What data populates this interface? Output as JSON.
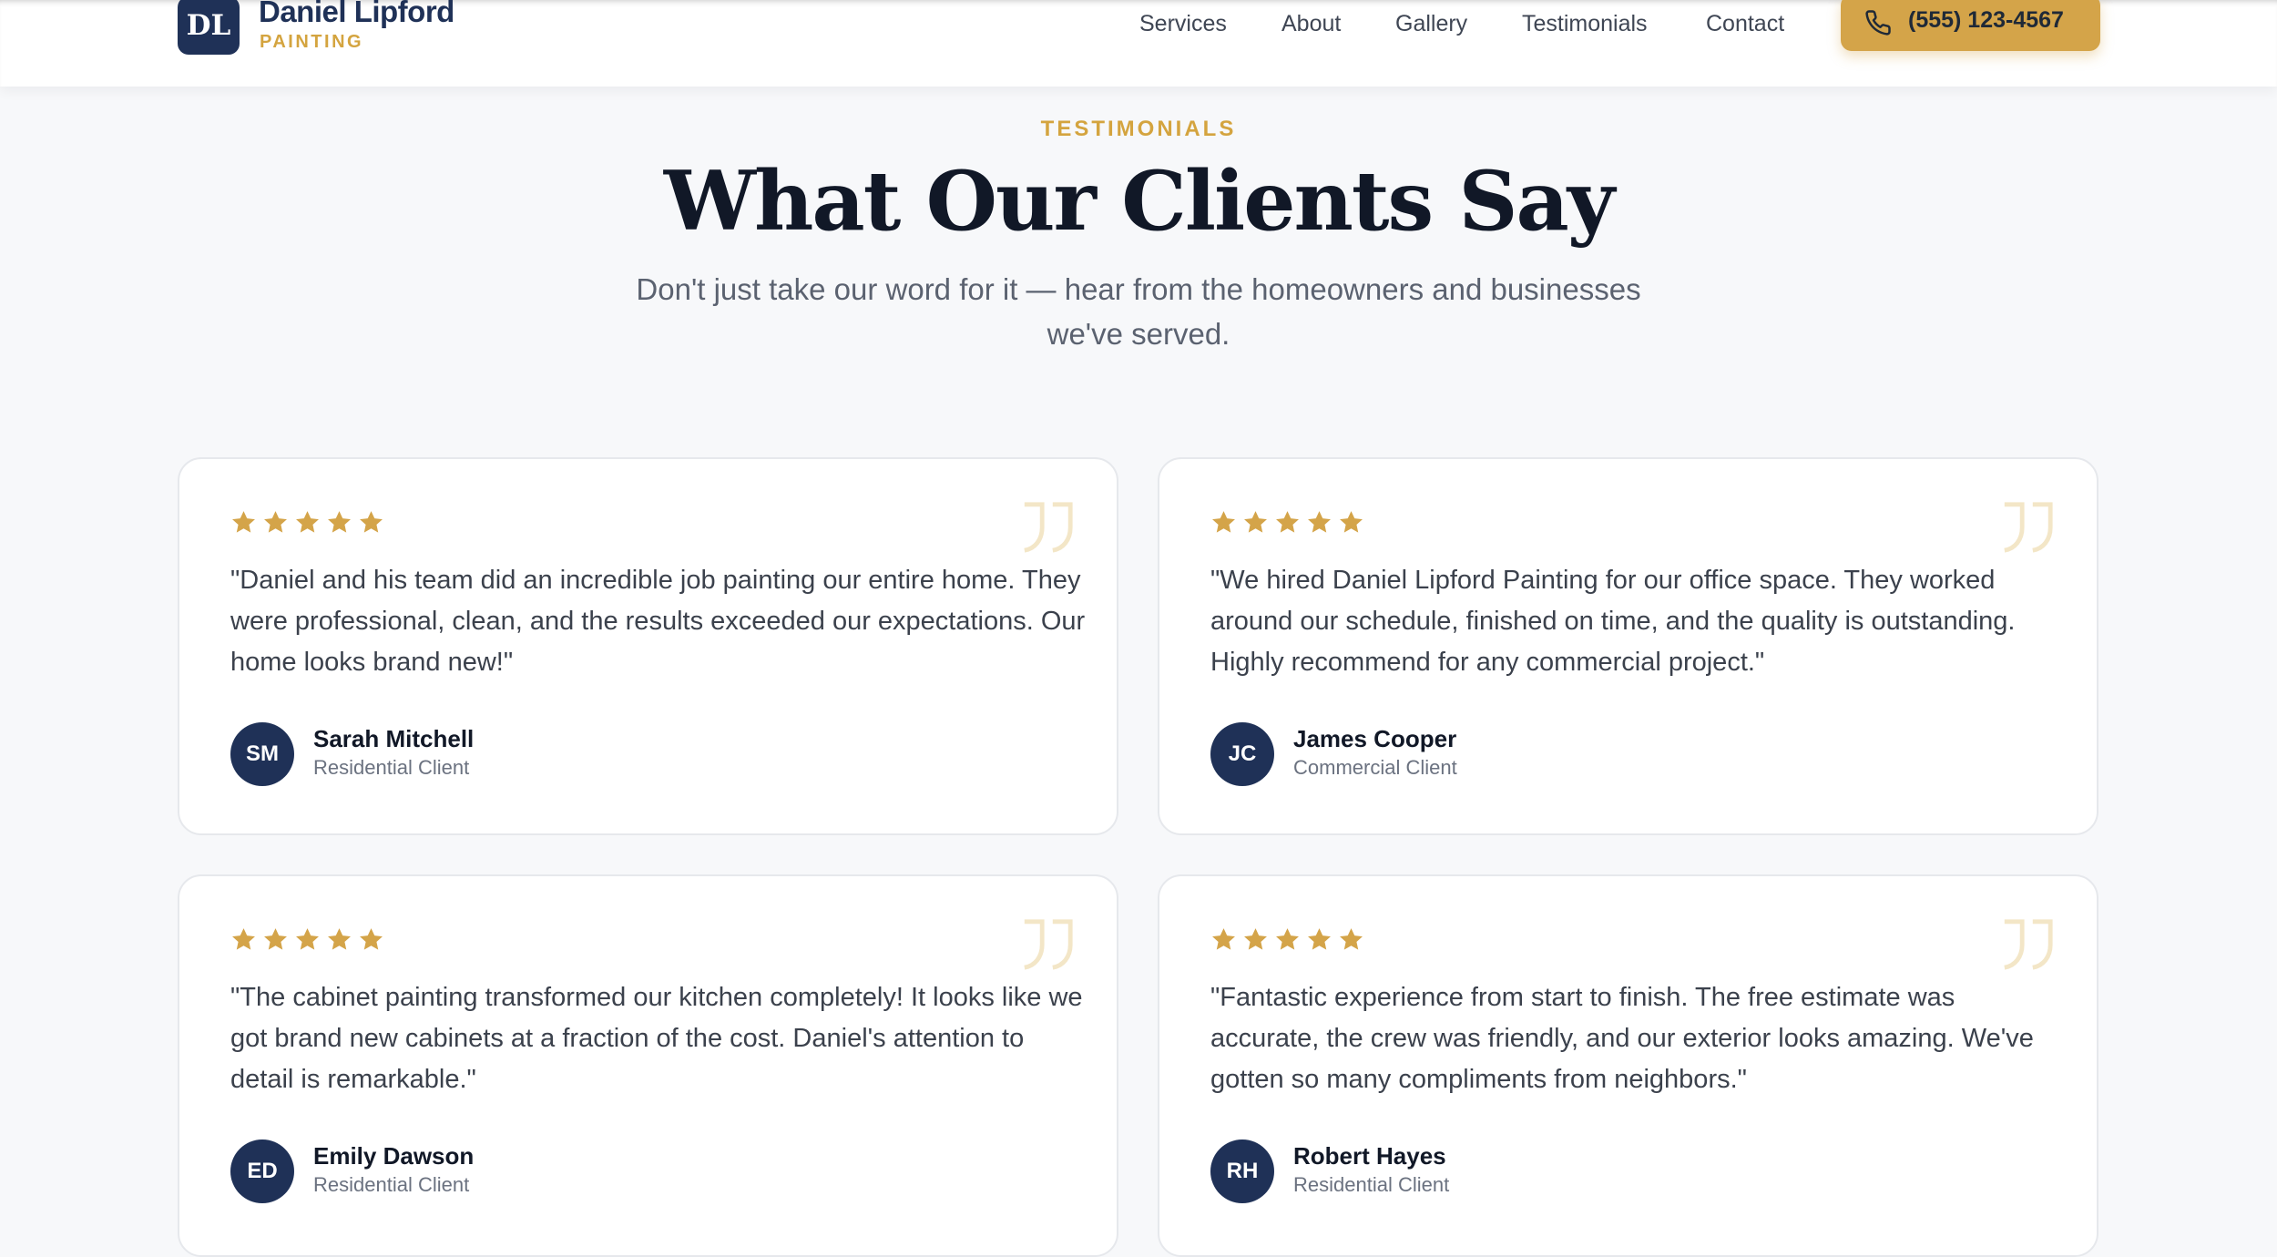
{
  "header": {
    "logo_initials": "DL",
    "brand_name": "Daniel Lipford",
    "brand_sub": "PAINTING",
    "nav": [
      "Services",
      "About",
      "Gallery",
      "Testimonials",
      "Contact"
    ],
    "phone": "(555) 123-4567",
    "phone_icon": "phone-icon"
  },
  "section": {
    "eyebrow": "TESTIMONIALS",
    "title": "What Our Clients Say",
    "subtitle": "Don't just take our word for it — hear from the homeowners and businesses we've served."
  },
  "testimonials": [
    {
      "rating": 5,
      "quote": "\"Daniel and his team did an incredible job painting our entire home. They were professional, clean, and the results exceeded our expectations. Our home looks brand new!\"",
      "initials": "SM",
      "name": "Sarah Mitchell",
      "role": "Residential Client"
    },
    {
      "rating": 5,
      "quote": "\"We hired Daniel Lipford Painting for our office space. They worked around our schedule, finished on time, and the quality is outstanding. Highly recommend for any commercial project.\"",
      "initials": "JC",
      "name": "James Cooper",
      "role": "Commercial Client"
    },
    {
      "rating": 5,
      "quote": "\"The cabinet painting transformed our kitchen completely! It looks like we got brand new cabinets at a fraction of the cost. Daniel's attention to detail is remarkable.\"",
      "initials": "ED",
      "name": "Emily Dawson",
      "role": "Residential Client"
    },
    {
      "rating": 5,
      "quote": "\"Fantastic experience from start to finish. The free estimate was accurate, the crew was friendly, and our exterior looks amazing. We've gotten so many compliments from neighbors.\"",
      "initials": "RH",
      "name": "Robert Hayes",
      "role": "Residential Client"
    }
  ],
  "colors": {
    "navy": "#1f3157",
    "gold": "#d4a449",
    "quote_mark": "#f3e6c7",
    "background": "#f7f8fa"
  }
}
